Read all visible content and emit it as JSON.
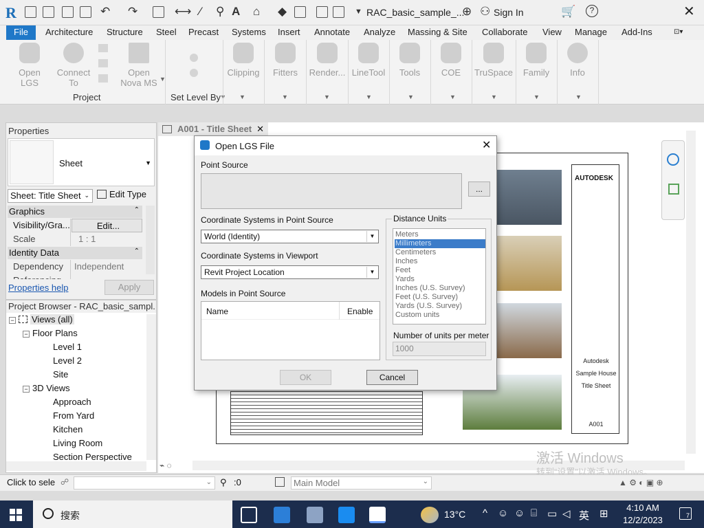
{
  "app": {
    "logo": "R",
    "document_title": "RAC_basic_sample_...",
    "sign_in": "Sign In",
    "help": "?"
  },
  "tabs": [
    {
      "label": "Architecture"
    },
    {
      "label": "Structure"
    },
    {
      "label": "Steel"
    },
    {
      "label": "Precast"
    },
    {
      "label": "Systems"
    },
    {
      "label": "Insert"
    },
    {
      "label": "Annotate"
    },
    {
      "label": "Analyze"
    },
    {
      "label": "Massing & Site"
    },
    {
      "label": "Collaborate"
    },
    {
      "label": "View"
    },
    {
      "label": "Manage"
    },
    {
      "label": "Add-Ins"
    }
  ],
  "file_tab": "File",
  "ribbon": {
    "open_lgs": "Open\nLGS",
    "connect_to": "Connect\nTo",
    "open_nova": "Open\nNova MS",
    "project_label": "Project",
    "set_level_by": "Set Level By",
    "buttons": [
      "Clipping",
      "Fitters",
      "Render...",
      "LineTool",
      "Tools",
      "COE",
      "TruSpace",
      "Family",
      "Info"
    ]
  },
  "properties": {
    "title": "Properties",
    "type_name": "Sheet",
    "type_select": "Sheet: Title Sheet",
    "edit_type": "Edit Type",
    "cat_graphics": "Graphics",
    "visibility_key": "Visibility/Gra...",
    "visibility_val": "Edit...",
    "scale_key": "Scale",
    "scale_val": "1 : 1",
    "cat_identity": "Identity Data",
    "dependency_key": "Dependency",
    "dependency_val": "Independent",
    "referencing_key": "Referencing",
    "help": "Properties help",
    "apply": "Apply"
  },
  "browser": {
    "title": "Project Browser - RAC_basic_sampl...",
    "nodes": [
      {
        "label": "Views (all)"
      },
      {
        "label": "Floor Plans"
      },
      {
        "label": "Level 1"
      },
      {
        "label": "Level 2"
      },
      {
        "label": "Site"
      },
      {
        "label": "3D Views"
      },
      {
        "label": "Approach"
      },
      {
        "label": "From Yard"
      },
      {
        "label": "Kitchen"
      },
      {
        "label": "Living Room"
      },
      {
        "label": "Section Perspective"
      }
    ]
  },
  "view_tab": "A001 - Title Sheet",
  "sheet": {
    "logo": "AUTODESK",
    "company": "Autodesk",
    "project": "Sample House",
    "sheet_name": "Title Sheet",
    "number": "A001"
  },
  "dialog": {
    "title": "Open LGS File",
    "point_source": "Point Source",
    "browse": "...",
    "coord_in_source": "Coordinate Systems in Point Source",
    "coord_source_value": "World (Identity)",
    "coord_in_viewport": "Coordinate Systems in Viewport",
    "coord_viewport_value": "Revit Project Location",
    "models_label": "Models in Point Source",
    "col_name": "Name",
    "col_enable": "Enable",
    "distance_units": "Distance Units",
    "units": [
      "Meters",
      "Millimeters",
      "Centimeters",
      "Inches",
      "Feet",
      "Yards",
      "Inches (U.S. Survey)",
      "Feet (U.S. Survey)",
      "Yards (U.S. Survey)",
      "Custom units"
    ],
    "selected_unit": "Millimeters",
    "units_per_meter_label": "Number of units per meter",
    "units_per_meter": "1000",
    "ok": "OK",
    "cancel": "Cancel"
  },
  "status": {
    "text": "Click to sele",
    "zero": ":0",
    "model": "Main Model"
  },
  "watermark": {
    "line1": "激活 Windows",
    "line2": "转到“设置”以激活 Windows。"
  },
  "taskbar": {
    "search": "搜索",
    "temp": "13°C",
    "ime": "英",
    "time": "4:10 AM",
    "date": "12/2/2023",
    "notif_count": "7"
  },
  "colors": {
    "accent": "#1f78c8",
    "selection": "#3b7cc9",
    "taskbar": "#1c2d4d"
  }
}
